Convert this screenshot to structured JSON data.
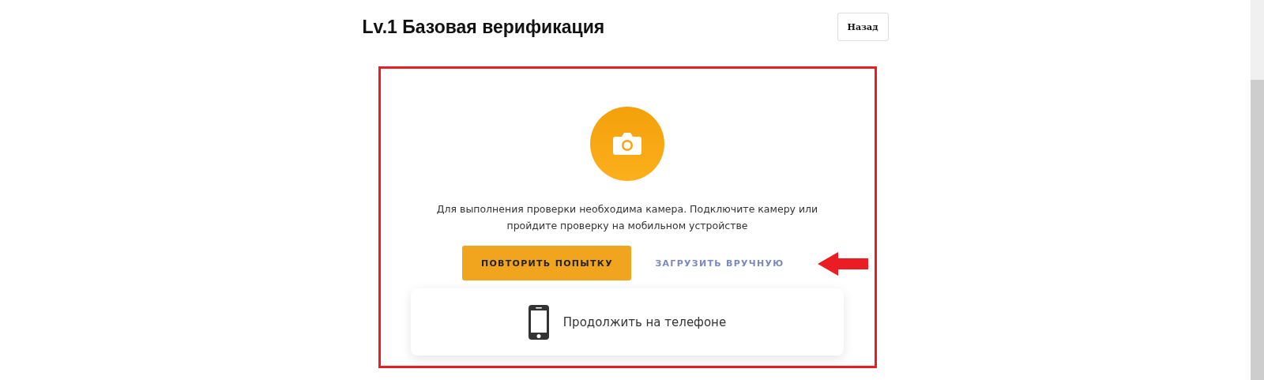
{
  "title": "Lv.1 Базовая верификация",
  "back_button": "Назад",
  "message": "Для выполнения проверки необходима камера. Подключите камеру или пройдите проверку на мобильном устройстве",
  "retry_button": "ПОВТОРИТЬ ПОПЫТКУ",
  "manual_button": "ЗАГРУЗИТЬ ВРУЧНУЮ",
  "phone_option": "Продолжить на телефоне"
}
